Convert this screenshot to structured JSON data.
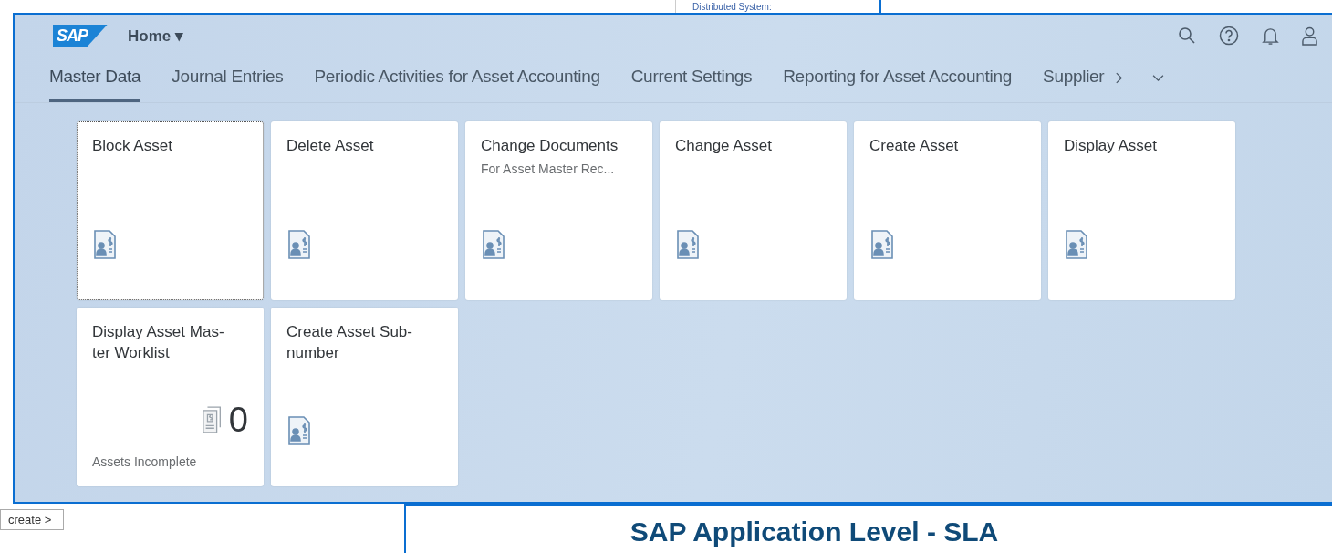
{
  "background": {
    "top_label": "Distributed System:",
    "button": "create >",
    "heading": "SAP Application Level - SLA"
  },
  "shell": {
    "logo": "SAP",
    "home": "Home",
    "home_caret": "▾"
  },
  "tabs": [
    {
      "label": "Master Data",
      "selected": true
    },
    {
      "label": "Journal Entries",
      "selected": false
    },
    {
      "label": "Periodic Activities for Asset Accounting",
      "selected": false
    },
    {
      "label": "Current Settings",
      "selected": false
    },
    {
      "label": "Reporting for Asset Accounting",
      "selected": false
    },
    {
      "label": "Supplier",
      "selected": false
    }
  ],
  "tiles": [
    {
      "kind": "launch",
      "title": "Block Asset",
      "focused": true
    },
    {
      "kind": "launch",
      "title": "Delete Asset",
      "focused": false
    },
    {
      "kind": "launch",
      "title": "Change Documents",
      "subtitle": "For Asset Master Rec...",
      "focused": false
    },
    {
      "kind": "launch",
      "title": "Change Asset",
      "focused": false
    },
    {
      "kind": "launch",
      "title": "Create Asset",
      "focused": false
    },
    {
      "kind": "launch",
      "title": "Display Asset",
      "focused": false
    },
    {
      "kind": "kpi",
      "title": "Display Asset Mas-\nter Worklist",
      "value": "0",
      "footer": "Assets Incomplete",
      "focused": false
    },
    {
      "kind": "launch",
      "title": "Create Asset Sub-\nnumber",
      "focused": false
    }
  ]
}
